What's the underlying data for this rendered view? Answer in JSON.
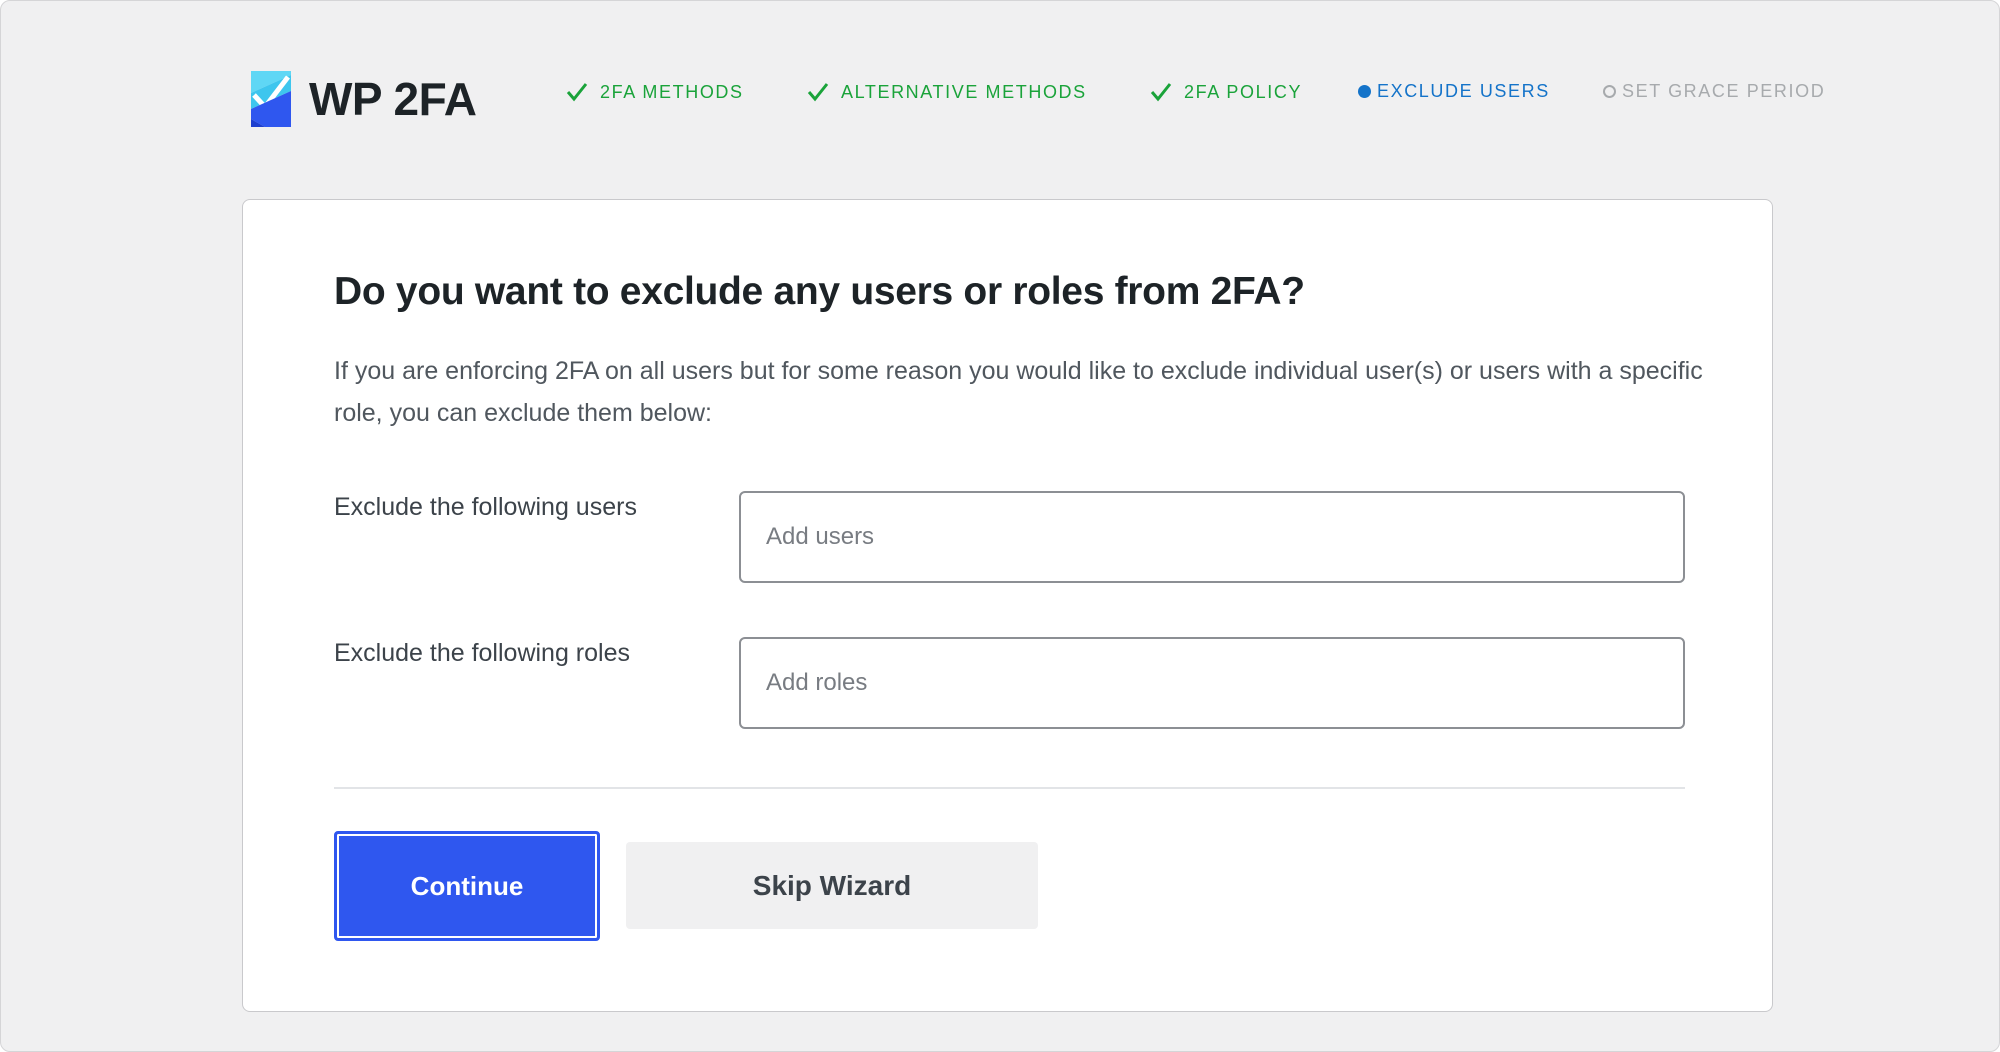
{
  "brand": {
    "name": "WP 2FA",
    "logo_icon": "wp2fa-logo-icon"
  },
  "steps": [
    {
      "label": "2FA METHODS",
      "status": "done"
    },
    {
      "label": "ALTERNATIVE METHODS",
      "status": "done"
    },
    {
      "label": "2FA POLICY",
      "status": "done"
    },
    {
      "label": "EXCLUDE USERS",
      "status": "current"
    },
    {
      "label": "SET GRACE PERIOD",
      "status": "upcoming"
    }
  ],
  "card": {
    "title": "Do you want to exclude any users or roles from 2FA?",
    "description": "If you are enforcing 2FA on all users but for some reason you would like to exclude individual user(s) or users with a specific role, you can exclude them below:",
    "users_field": {
      "label": "Exclude the following users",
      "placeholder": "Add users",
      "value": ""
    },
    "roles_field": {
      "label": "Exclude the following roles",
      "placeholder": "Add roles",
      "value": ""
    },
    "continue_label": "Continue",
    "skip_label": "Skip Wizard"
  },
  "colors": {
    "done": "#1aa33a",
    "current": "#1473c9",
    "upcoming": "#a7aaad",
    "primary_button": "#2f57ef",
    "page_background": "#f0f0f1"
  }
}
